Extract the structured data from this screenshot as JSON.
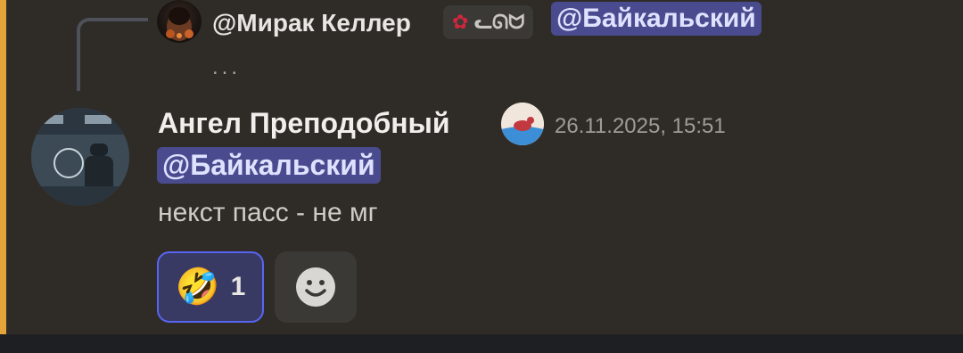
{
  "reply": {
    "author": "@Мирак Келлер",
    "clan_tag": "ᓚᘏᗢ",
    "mention": "@Байкальский",
    "snippet": "..."
  },
  "message": {
    "author": "Ангел Преподобный",
    "timestamp": "26.11.2025, 15:51",
    "mention": "@Байкальский",
    "text": "некст пасс - не мг"
  },
  "reactions": [
    {
      "emoji": "🤣",
      "count": "1"
    }
  ],
  "colors": {
    "background": "#2f2c28",
    "highlight_bar": "#e5a43a",
    "mention_bg": "#4a4b8f",
    "reaction_border": "#5865f2"
  },
  "icons": [
    "clan-leaf-icon",
    "role-seal-icon",
    "add-reaction-icon"
  ]
}
